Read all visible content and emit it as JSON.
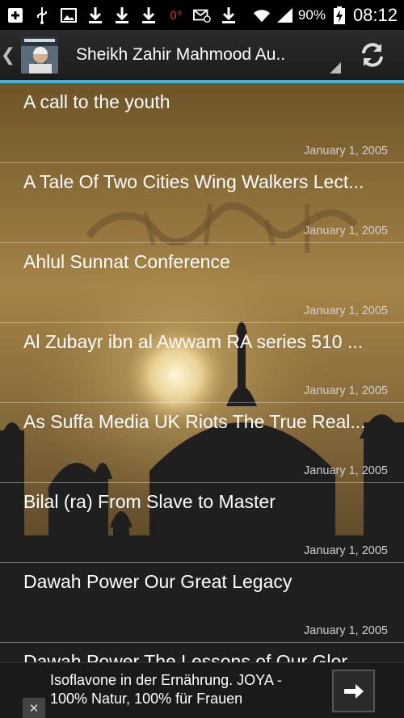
{
  "status_bar": {
    "icons": [
      "add-box-icon",
      "usb-icon",
      "image-icon",
      "download-icon",
      "download-icon",
      "download-icon",
      "thermometer-icon",
      "mail-muted-icon",
      "download-icon",
      "wifi-icon",
      "signal-icon",
      "battery-charging-icon"
    ],
    "battery": "90%",
    "time": "08:12"
  },
  "action_bar": {
    "title": "Sheikh Zahir Mahmood Au..",
    "app_icon": "sheikh-avatar-icon",
    "refresh_icon": "refresh-icon",
    "accent_color": "#33b5e5"
  },
  "lectures": [
    {
      "title": "A call to the youth",
      "date": "January 1, 2005"
    },
    {
      "title": "A Tale Of Two Cities Wing Walkers Lect...",
      "date": "January 1, 2005"
    },
    {
      "title": "Ahlul Sunnat Conference",
      "date": "January 1, 2005"
    },
    {
      "title": "Al Zubayr ibn al Awwam RA series 510 ...",
      "date": "January 1, 2005"
    },
    {
      "title": "As Suffa Media UK Riots The True Real...",
      "date": "January 1, 2005"
    },
    {
      "title": "Bilal (ra) From Slave to Master",
      "date": "January 1, 2005"
    },
    {
      "title": "Dawah Power Our Great Legacy",
      "date": "January 1, 2005"
    },
    {
      "title": "Dawah Power The Lessons of Our Glor...",
      "date": ""
    }
  ],
  "ad": {
    "text": "Isoflavone in der Ernährung. JOYA - 100% Natur, 100% für Frauen",
    "close_label": "✕"
  }
}
